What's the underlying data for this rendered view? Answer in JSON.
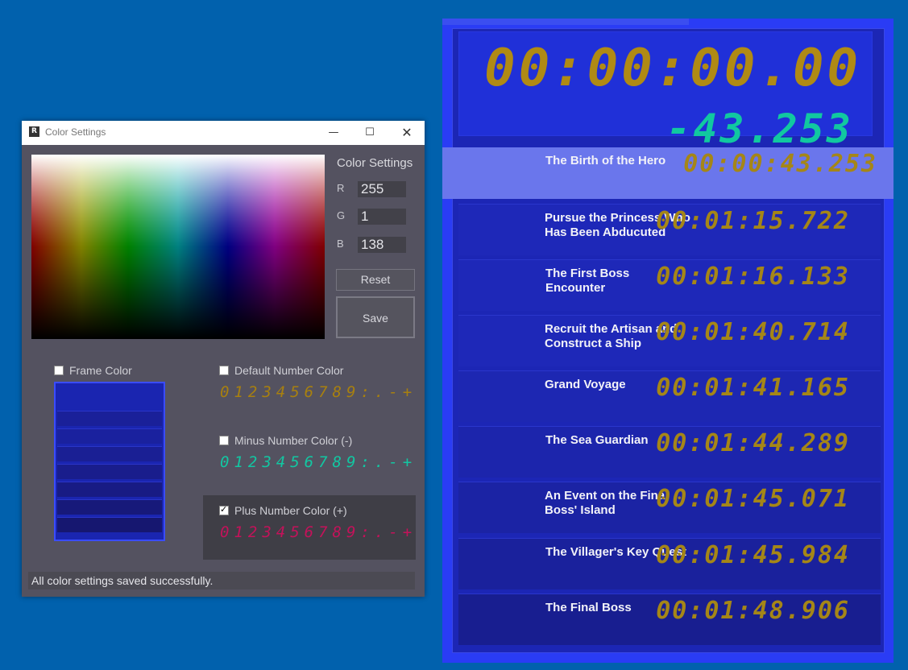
{
  "settings_window": {
    "title": "Color Settings",
    "controls": {
      "minimize": "—",
      "maximize": "☐",
      "close": "✕"
    },
    "heading": "Color Settings",
    "channels": [
      {
        "label": "R",
        "value": "255"
      },
      {
        "label": "G",
        "value": "1"
      },
      {
        "label": "B",
        "value": "138"
      }
    ],
    "reset_label": "Reset",
    "save_label": "Save",
    "options": {
      "frame": {
        "label": "Frame Color",
        "checked": false
      },
      "default": {
        "label": "Default Number Color",
        "checked": false,
        "sample": "0123456789:.-+",
        "color": "#a8800f"
      },
      "minus": {
        "label": "Minus Number Color (-)",
        "checked": false,
        "sample": "0123456789:.-+",
        "color": "#12c7a2"
      },
      "plus": {
        "label": "Plus Number Color (+)",
        "checked": true,
        "sample": "0123456789:.-+",
        "color": "#c4125a"
      }
    },
    "status": "All color settings saved successfully."
  },
  "timer": {
    "main_time": "00:00:00.00",
    "delta": "-43.253",
    "colors": {
      "frame": "#2a3cf5",
      "digits": "#a58617",
      "minus": "#11c8a0",
      "highlight": "#6a76ec"
    },
    "splits": [
      {
        "name": "The Birth of the Hero",
        "time": "00:00:43.253",
        "active": true
      },
      {
        "name": "Pursue the Princess Who Has Been Abducuted",
        "time": "00:01:15.722"
      },
      {
        "name": "The First Boss Encounter",
        "time": "00:01:16.133"
      },
      {
        "name": "Recruit the Artisan and Construct a Ship",
        "time": "00:01:40.714"
      },
      {
        "name": "Grand Voyage",
        "time": "00:01:41.165"
      },
      {
        "name": "The Sea Guardian",
        "time": "00:01:44.289"
      },
      {
        "name": "An Event on the Fina Boss' Island",
        "time": "00:01:45.071"
      },
      {
        "name": "The Villager's Key Quest",
        "time": "00:01:45.984"
      },
      {
        "name": "The Final Boss",
        "time": "00:01:48.906"
      }
    ]
  }
}
